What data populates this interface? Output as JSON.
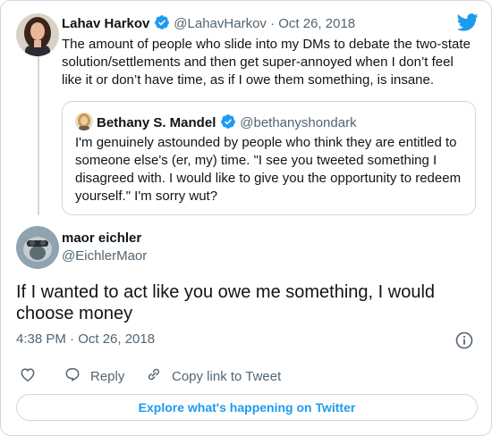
{
  "parent_tweet": {
    "author_name": "Lahav Harkov",
    "author_handle": "@LahavHarkov",
    "date_separator": " · ",
    "date": "Oct 26, 2018",
    "text": "The amount of people who slide into my DMs to debate the two-state solution/settlements and then get super-annoyed when I don’t feel like it or don’t have time, as if I owe them something, is insane."
  },
  "quoted_tweet": {
    "author_name": "Bethany S. Mandel",
    "author_handle": "@bethanyshondark",
    "text": "I'm genuinely astounded by people who think they are entitled to someone else's (er, my) time. \"I see you tweeted something I disagreed with. I would like to give you the opportunity to redeem yourself.\"   I'm sorry wut?"
  },
  "main_tweet": {
    "author_name": "maor eichler",
    "author_handle": "@EichlerMaor",
    "text": "If I wanted to act like you owe me something, I would choose money",
    "time": "4:38 PM · Oct 26, 2018"
  },
  "actions": {
    "reply_label": "Reply",
    "copy_link_label": "Copy link to Tweet"
  },
  "footer": {
    "explore_label": "Explore what's happening on Twitter"
  },
  "colors": {
    "accent": "#1d9bf0",
    "text": "#0f1419",
    "secondary_text": "#536471",
    "border": "#cfd9de"
  },
  "icons": [
    "twitter-bird-icon",
    "verified-badge-icon",
    "info-icon",
    "heart-icon",
    "reply-icon",
    "link-icon"
  ]
}
